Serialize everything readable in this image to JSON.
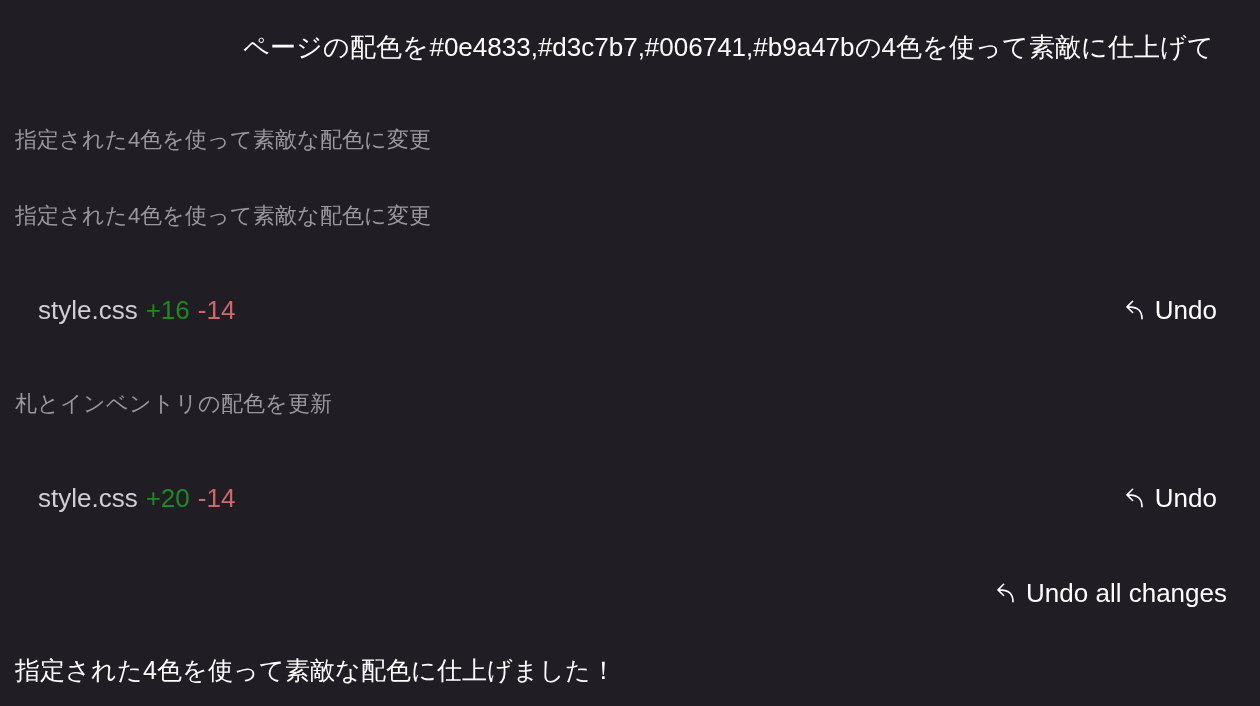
{
  "user_message": "ページの配色を#0e4833,#d3c7b7,#006741,#b9a47bの4色を使って素敵に仕上げて",
  "steps": [
    {
      "kind": "note",
      "text": "指定された4色を使って素敵な配色に変更"
    },
    {
      "kind": "note",
      "text": "指定された4色を使って素敵な配色に変更"
    },
    {
      "kind": "file_change",
      "file": "style.css",
      "additions": "+16",
      "deletions": "-14",
      "undo_label": "Undo"
    },
    {
      "kind": "note",
      "text": "札とインベントリの配色を更新"
    },
    {
      "kind": "file_change",
      "file": "style.css",
      "additions": "+20",
      "deletions": "-14",
      "undo_label": "Undo"
    }
  ],
  "undo_all": {
    "label": "Undo all changes"
  },
  "assistant_message": "指定された4色を使って素敵な配色に仕上げました！"
}
